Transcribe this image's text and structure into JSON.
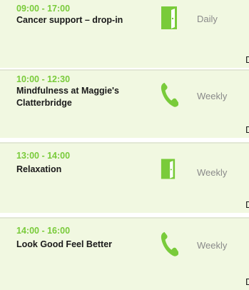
{
  "sessions": [
    {
      "time": "09:00 - 17:00",
      "title": "Cancer support – drop-in",
      "icon": "door-icon",
      "frequency": "Daily",
      "cut_text": "D"
    },
    {
      "time": "10:00 - 12:30",
      "title": "Mindfulness at Maggie's Clatterbridge",
      "icon": "phone-icon",
      "frequency": "Weekly",
      "cut_text": "D"
    },
    {
      "time": "13:00 - 14:00",
      "title": "Relaxation",
      "icon": "door-icon",
      "frequency": "Weekly",
      "cut_text": "D"
    },
    {
      "time": "14:00 - 16:00",
      "title": "Look Good Feel Better",
      "icon": "phone-icon",
      "frequency": "Weekly",
      "cut_text": "D"
    }
  ],
  "colors": {
    "accent": "#79cb3a",
    "card_bg": "#f1f8e1",
    "text": "#1a1a1a",
    "muted": "#8a8a8a"
  }
}
